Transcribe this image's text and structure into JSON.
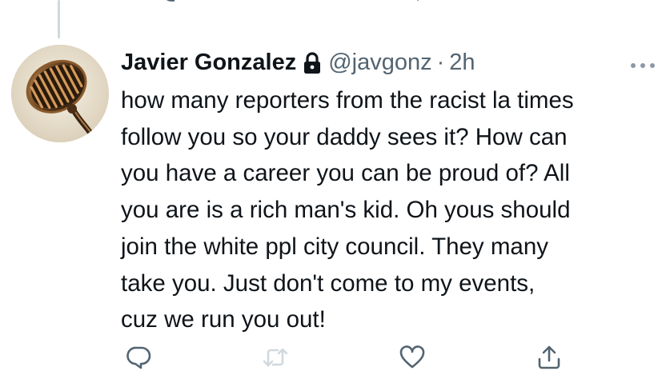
{
  "tweet": {
    "author": {
      "display_name": "Javier Gonzalez",
      "handle": "@javgonz",
      "protected_icon": "lock-icon",
      "avatar_icon": "vintage-microphone-avatar"
    },
    "separator": "·",
    "time": "2h",
    "text_lines": [
      "how many reporters from the racist la times",
      "follow you so your daddy sees it? How can",
      "you have a career you can be proud of? All",
      "you are is a rich man's kid. Oh yous should",
      "join the white ppl city council. They many",
      "take you. Just don't come to my events,",
      "cuz we run you out!"
    ],
    "actions": [
      {
        "name": "reply",
        "icon": "reply-icon"
      },
      {
        "name": "retweet",
        "icon": "retweet-icon"
      },
      {
        "name": "like",
        "icon": "heart-icon"
      },
      {
        "name": "share",
        "icon": "share-icon"
      }
    ],
    "more_icon": "more-icon"
  },
  "colors": {
    "text": "#0f1419",
    "secondary": "#536471",
    "thread_line": "#cfd9de",
    "action_icon": "#536471",
    "retweet_disabled": "#cfd9de"
  }
}
